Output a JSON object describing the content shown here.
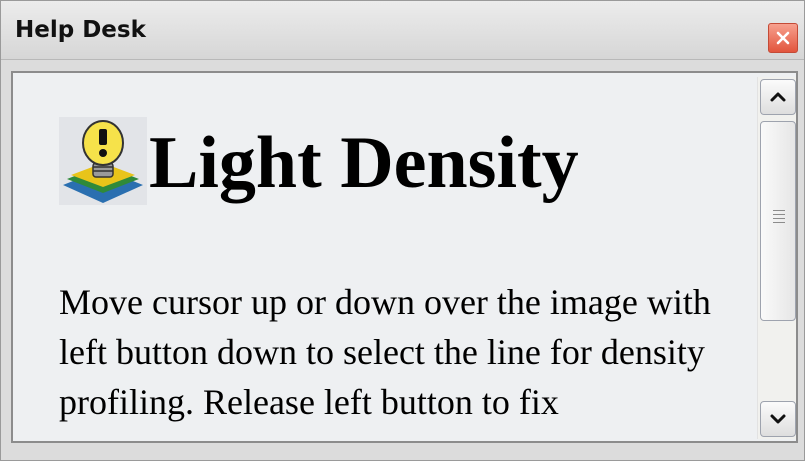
{
  "window": {
    "title": "Help Desk",
    "close_icon": "close-icon"
  },
  "heading": {
    "icon": "lightbulb-icon",
    "text": "Light Density"
  },
  "body": {
    "paragraph": "Move cursor up or down over the image with left button down to select the line for density profiling. Release left button to fix"
  },
  "scrollbar": {
    "up_icon": "chevron-up-icon",
    "down_icon": "chevron-down-icon"
  },
  "colors": {
    "close_button": "#e2553d",
    "content_background": "#eef0f2",
    "titlebar": "#dcdcdc"
  }
}
